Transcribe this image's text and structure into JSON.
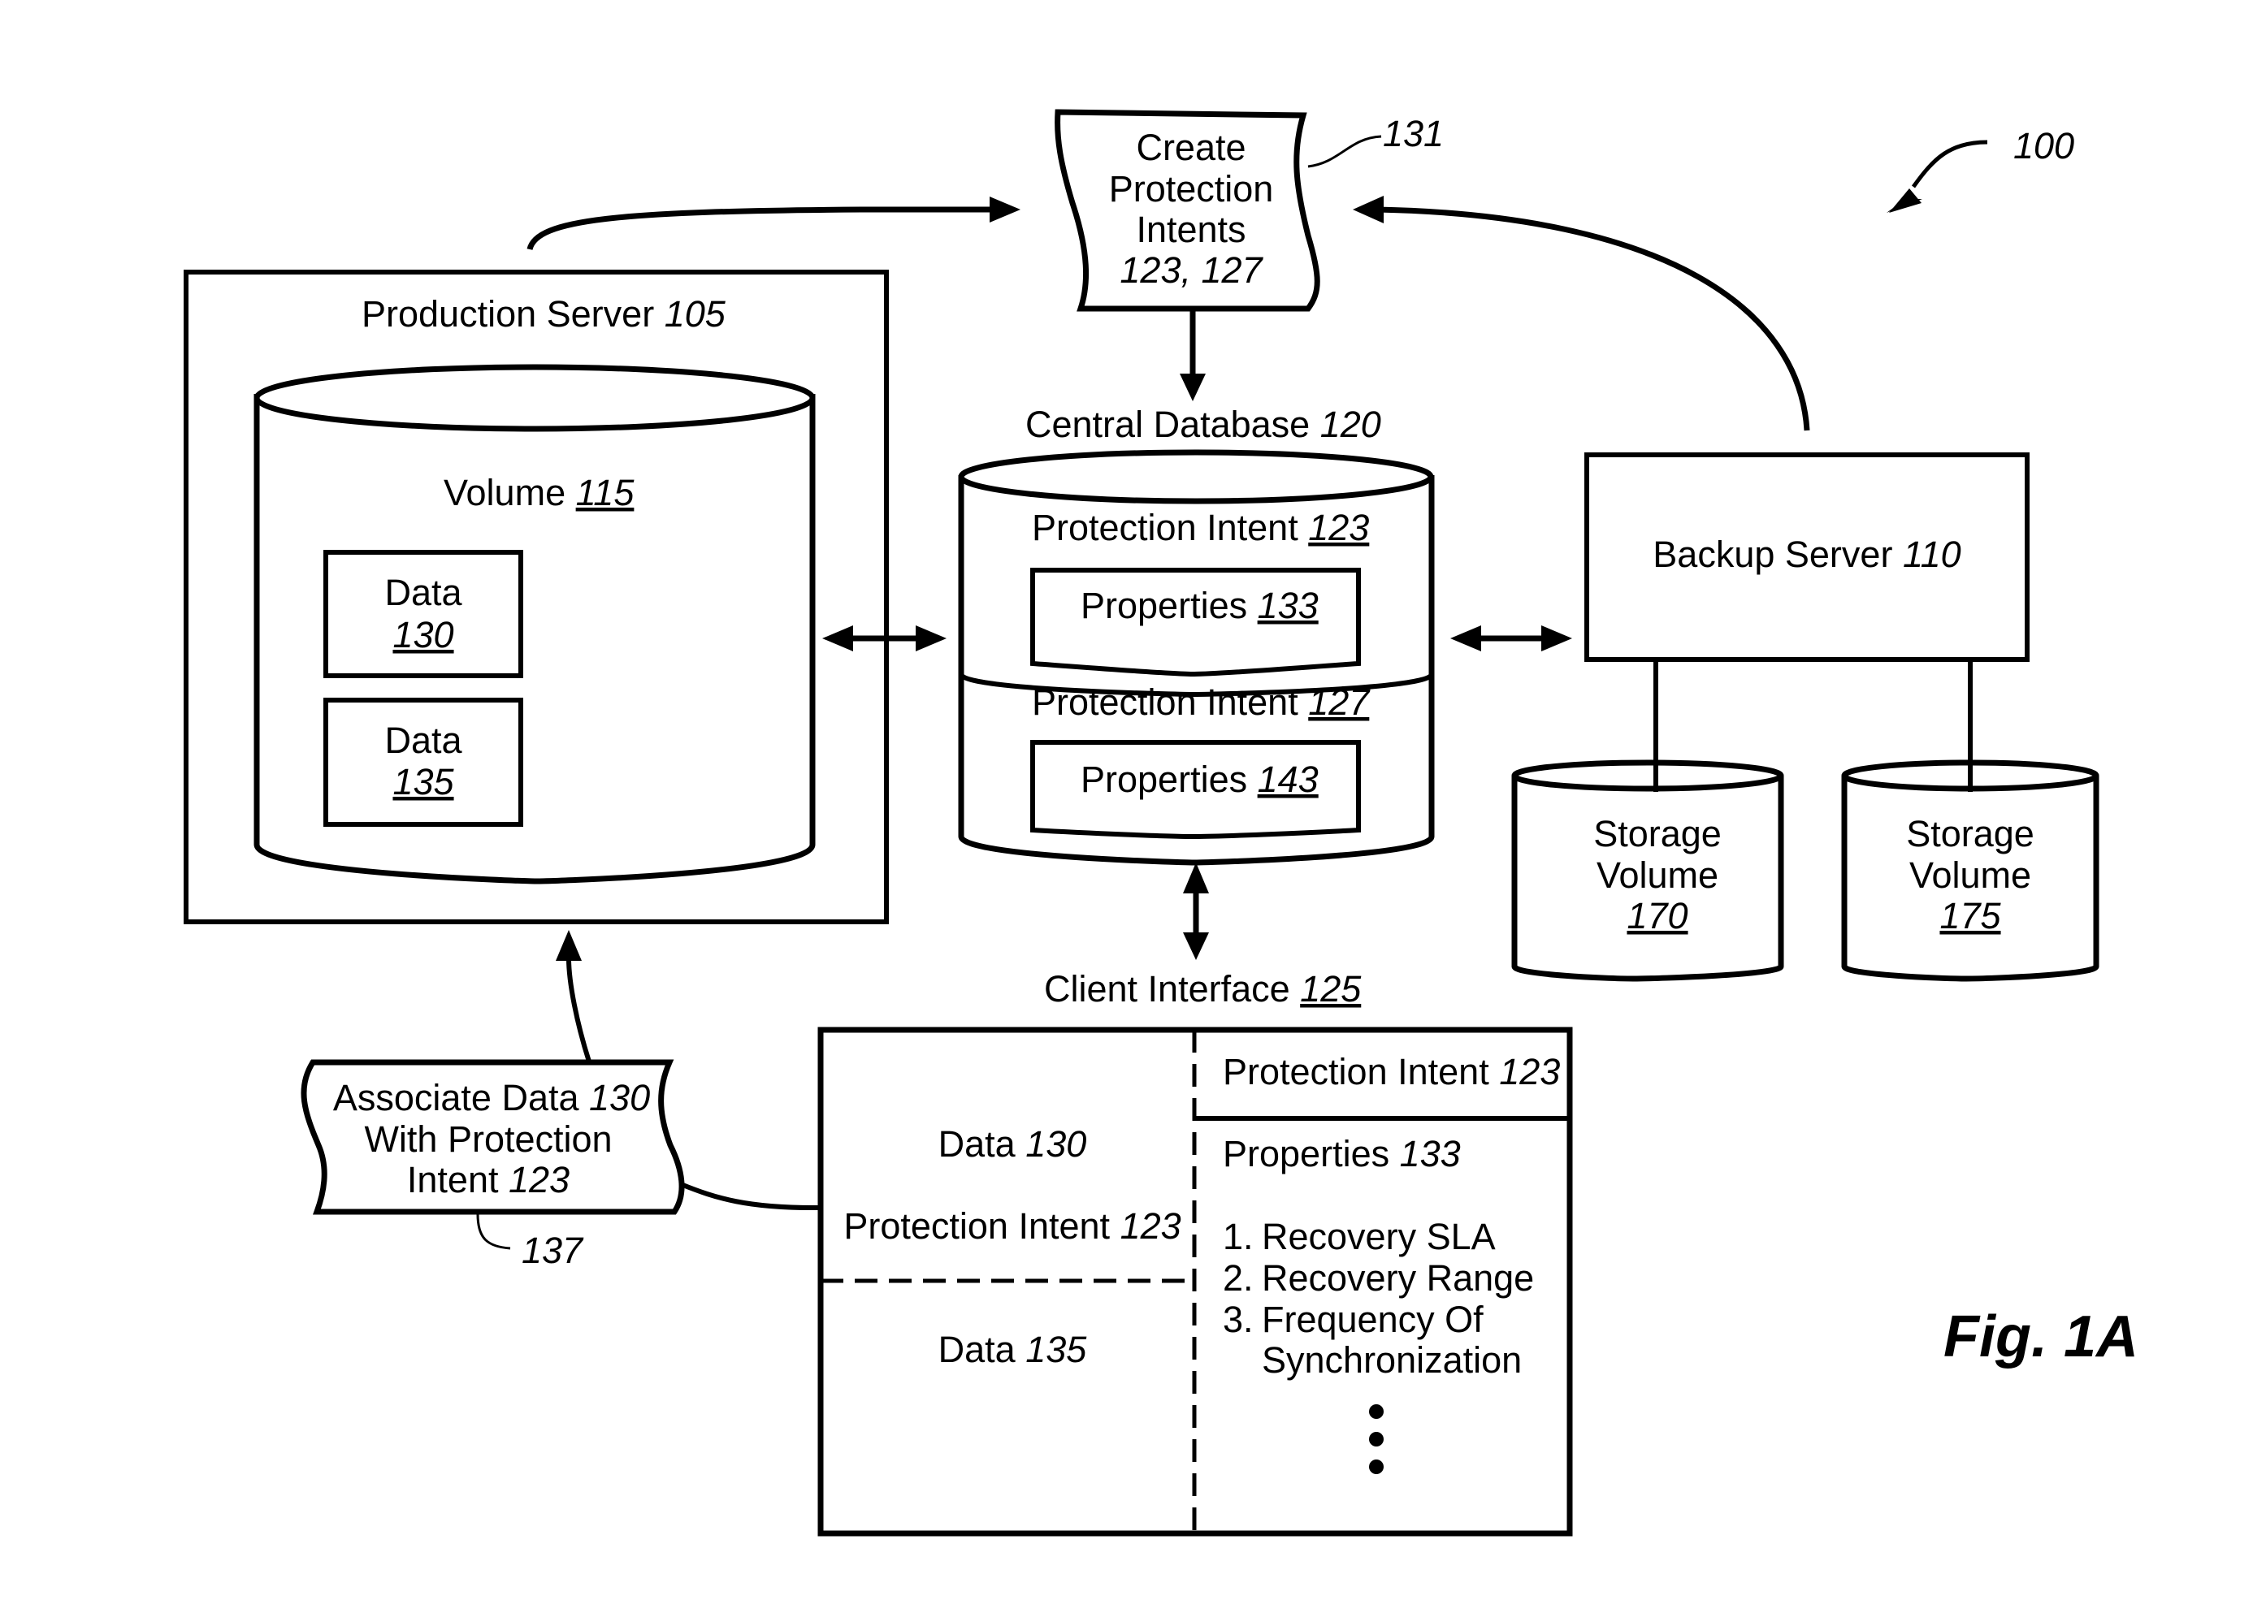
{
  "figure": {
    "figure_label": "Fig. 1A",
    "system_ref": "100"
  },
  "production_server": {
    "title": "Production Server",
    "ref": "105",
    "volume": {
      "title": "Volume",
      "ref": "115"
    },
    "data_items": [
      {
        "title": "Data",
        "ref": "130"
      },
      {
        "title": "Data",
        "ref": "135"
      }
    ]
  },
  "create_intents": {
    "lines": [
      "Create",
      "Protection",
      "Intents"
    ],
    "refs": "123, 127",
    "callout_ref": "131"
  },
  "central_database": {
    "title": "Central Database",
    "ref": "120",
    "intents": [
      {
        "title": "Protection Intent",
        "ref": "123",
        "properties": {
          "title": "Properties",
          "ref": "133"
        }
      },
      {
        "title": "Protection Intent",
        "ref": "127",
        "properties": {
          "title": "Properties",
          "ref": "143"
        }
      }
    ]
  },
  "backup_server": {
    "title": "Backup Server",
    "ref": "110",
    "storage_volumes": [
      {
        "line1": "Storage",
        "line2": "Volume",
        "ref": "170"
      },
      {
        "line1": "Storage",
        "line2": "Volume",
        "ref": "175"
      }
    ]
  },
  "associate_step": {
    "line1": "Associate Data",
    "line1_ref": "130",
    "line2": "With Protection",
    "line3": "Intent",
    "line3_ref": "123",
    "callout_ref": "137"
  },
  "client_interface": {
    "title": "Client Interface",
    "ref": "125",
    "left": {
      "data_a": {
        "title": "Data",
        "ref": "130"
      },
      "intent": {
        "title": "Protection Intent",
        "ref": "123"
      },
      "data_b": {
        "title": "Data",
        "ref": "135"
      }
    },
    "right": {
      "intent_header": {
        "title": "Protection Intent",
        "ref": "123"
      },
      "properties_header": {
        "title": "Properties",
        "ref": "133"
      },
      "properties_list": [
        {
          "num": "1.",
          "text": "Recovery SLA"
        },
        {
          "num": "2.",
          "text": "Recovery Range"
        },
        {
          "num": "3.",
          "text": "Frequency Of"
        },
        {
          "num": "",
          "text": "Synchronization"
        }
      ],
      "ellipsis": "⋮"
    }
  }
}
